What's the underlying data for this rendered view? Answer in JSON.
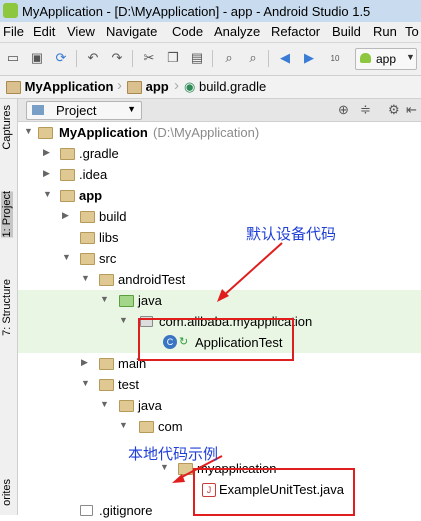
{
  "window": {
    "title": "MyApplication - [D:\\MyApplication] - app - Android Studio 1.5"
  },
  "menu": [
    "File",
    "Edit",
    "View",
    "Navigate",
    "Code",
    "Analyze",
    "Refactor",
    "Build",
    "Run",
    "To"
  ],
  "toolbar": {
    "run_config": "app",
    "icons": [
      "open-icon",
      "save-icon",
      "sync-icon",
      "undo-icon",
      "redo-icon",
      "cut-icon",
      "copy-icon",
      "paste-icon",
      "find-icon",
      "replace-icon",
      "back-icon",
      "forward-icon",
      "binary-icon",
      "android-icon"
    ]
  },
  "breadcrumb": [
    {
      "label": "MyApplication"
    },
    {
      "label": "app"
    },
    {
      "label": "build.gradle"
    }
  ],
  "side_tabs": [
    "Captures",
    "1: Project",
    "7: Structure",
    "orites"
  ],
  "panel": {
    "view_label": "Project"
  },
  "tree": [
    {
      "label": "MyApplication",
      "path": "(D:\\MyApplication)"
    },
    {
      "label": ".gradle"
    },
    {
      "label": ".idea"
    },
    {
      "label": "app"
    },
    {
      "label": "build"
    },
    {
      "label": "libs"
    },
    {
      "label": "src"
    },
    {
      "label": "androidTest"
    },
    {
      "label": "java"
    },
    {
      "label": "com.alibaba.myapplication"
    },
    {
      "label": "ApplicationTest"
    },
    {
      "label": "main"
    },
    {
      "label": "test"
    },
    {
      "label": "java"
    },
    {
      "label": "com"
    },
    {
      "label": "myapplication"
    },
    {
      "label": "ExampleUnitTest.java"
    },
    {
      "label": ".gitignore"
    }
  ],
  "annotations": {
    "default_test": "默认设备代码",
    "local_test": "本地代码示例"
  },
  "colors": {
    "annotation_text": "#1f3fd6",
    "annotation_box": "#e01e1e",
    "highlight_row": "#eaf6e4"
  }
}
